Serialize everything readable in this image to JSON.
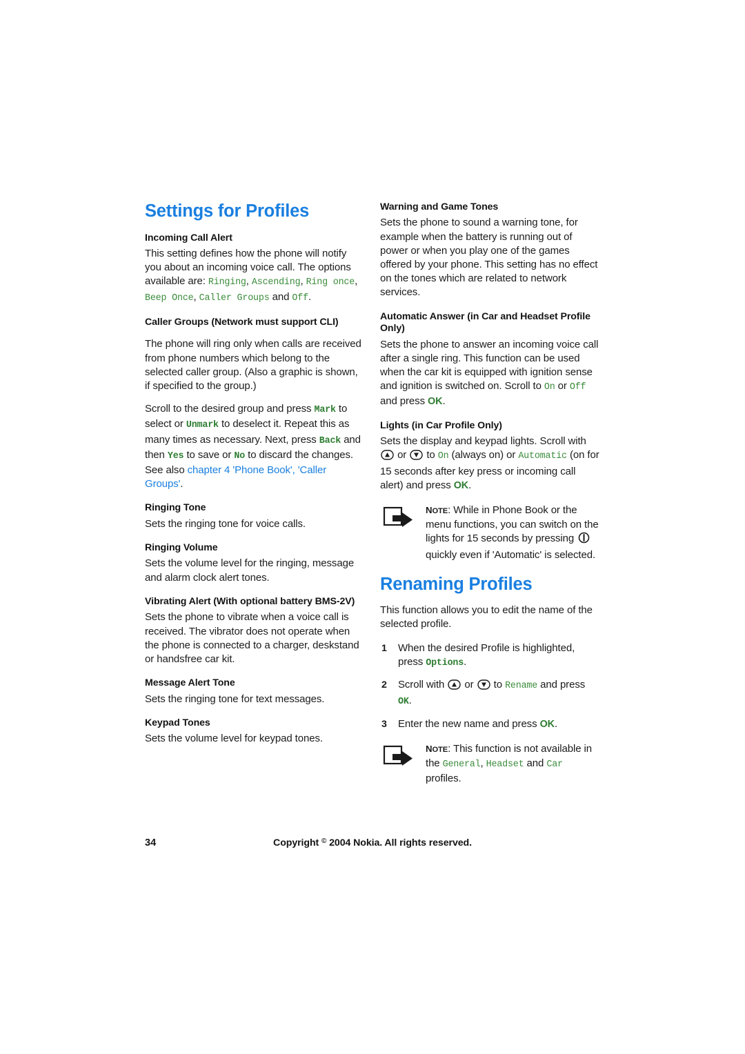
{
  "document": {
    "left_column": {
      "chapter_heading": "Settings for Profiles",
      "sections": [
        {
          "heading": "Incoming Call Alert",
          "body_lead": "This setting defines how the phone will notify you about an incoming voice call. The options available are: ",
          "options": [
            "Ringing",
            "Ascending",
            "Ring once",
            "Beep Once",
            "Caller Groups",
            "Off"
          ],
          "body_conjunction": " and ",
          "body_end": "."
        },
        {
          "heading": "Caller Groups (Network must support CLI)",
          "para1": "The phone will ring only when calls are received from phone numbers which belong to the selected caller group. (Also a graphic is shown, if specified to the group.)",
          "para2_part1": "Scroll to the desired group and press ",
          "key_mark": "Mark",
          "para2_part2": " to select or ",
          "key_unmark": "Unmark",
          "para2_part3": " to deselect it. Repeat this as many times as necessary. Next, press ",
          "key_back": "Back",
          "para2_part4": " and then ",
          "key_yes": "Yes",
          "para2_part5": " to save or ",
          "key_no": "No",
          "para2_part6": " to discard the changes. See also ",
          "xref": "chapter 4 'Phone Book', 'Caller Groups'",
          "para2_end": "."
        },
        {
          "heading": "Ringing Tone",
          "body": "Sets the ringing tone for voice calls."
        },
        {
          "heading": "Ringing Volume",
          "body": "Sets the volume level for the ringing, message and alarm clock alert tones."
        },
        {
          "heading": "Vibrating Alert (With optional battery BMS-2V)",
          "body": "Sets the phone to vibrate when a voice call is received. The vibrator does not operate when the phone is connected to a charger, deskstand or handsfree car kit."
        },
        {
          "heading": "Message Alert Tone",
          "body": "Sets the ringing tone for text messages."
        },
        {
          "heading": "Keypad Tones",
          "body": "Sets the volume level for keypad tones."
        }
      ]
    },
    "right_column": {
      "sections": [
        {
          "heading": "Warning and Game Tones",
          "body": "Sets the phone to sound a warning tone, for example when the battery is running out of power or when you play one of the games offered by your phone. This setting has no effect on the tones which are related to network services."
        },
        {
          "heading": "Automatic Answer (in Car and Headset Profile Only)",
          "body_part1": "Sets the phone to answer an incoming voice call after a single ring. This function can be used when the car kit is equipped with ignition sense and ignition is switched on. Scroll to ",
          "option_on": "On",
          "body_part2": " or ",
          "option_off": "Off",
          "body_part3": " and press ",
          "key_ok": "OK",
          "body_end": "."
        },
        {
          "heading": "Lights (in Car Profile Only)",
          "body_part1": "Sets the display and keypad lights. Scroll with ",
          "body_part2": " or ",
          "body_part3": " to ",
          "option_on": "On",
          "body_part4": " (always on) or ",
          "option_automatic": "Automatic",
          "body_part5": " (on for 15 seconds after key press or incoming call alert) and press ",
          "key_ok": "OK",
          "body_end": "."
        }
      ],
      "note1": {
        "label": "Note",
        "text_part1": ": While in Phone Book or the menu functions, you can switch on the lights for 15 seconds by pressing ",
        "text_part2": " quickly even if 'Automatic' is selected."
      },
      "chapter_heading": "Renaming Profiles",
      "renaming_intro": "This function allows you to edit the name of the selected profile.",
      "steps": [
        {
          "num": "1",
          "text_part1": "When the desired Profile is highlighted, press ",
          "key": "Options",
          "text_part2": "."
        },
        {
          "num": "2",
          "text_part1": "Scroll with ",
          "text_part2": " or ",
          "text_part3": " to ",
          "option": "Rename",
          "text_part4": " and press ",
          "key": "OK",
          "text_part5": "."
        },
        {
          "num": "3",
          "text_part1": "Enter the new name and press ",
          "key": "OK",
          "text_part2": "."
        }
      ],
      "note2": {
        "label": "Note",
        "text_part1": ": This function is not available in the ",
        "profile_general": "General",
        "text_part2": ", ",
        "profile_headset": "Headset",
        "text_part3": " and ",
        "profile_car": "Car",
        "text_part4": " profiles."
      }
    },
    "footer": {
      "page_number": "34",
      "copyright_pre": "Copyright ",
      "copyright_symbol": "©",
      "copyright_post": " 2004 Nokia. All rights reserved."
    },
    "colors": {
      "heading_blue": "#1a7fe0",
      "key_green": "#3c8c3c",
      "body_black": "#1c1c1c"
    }
  }
}
